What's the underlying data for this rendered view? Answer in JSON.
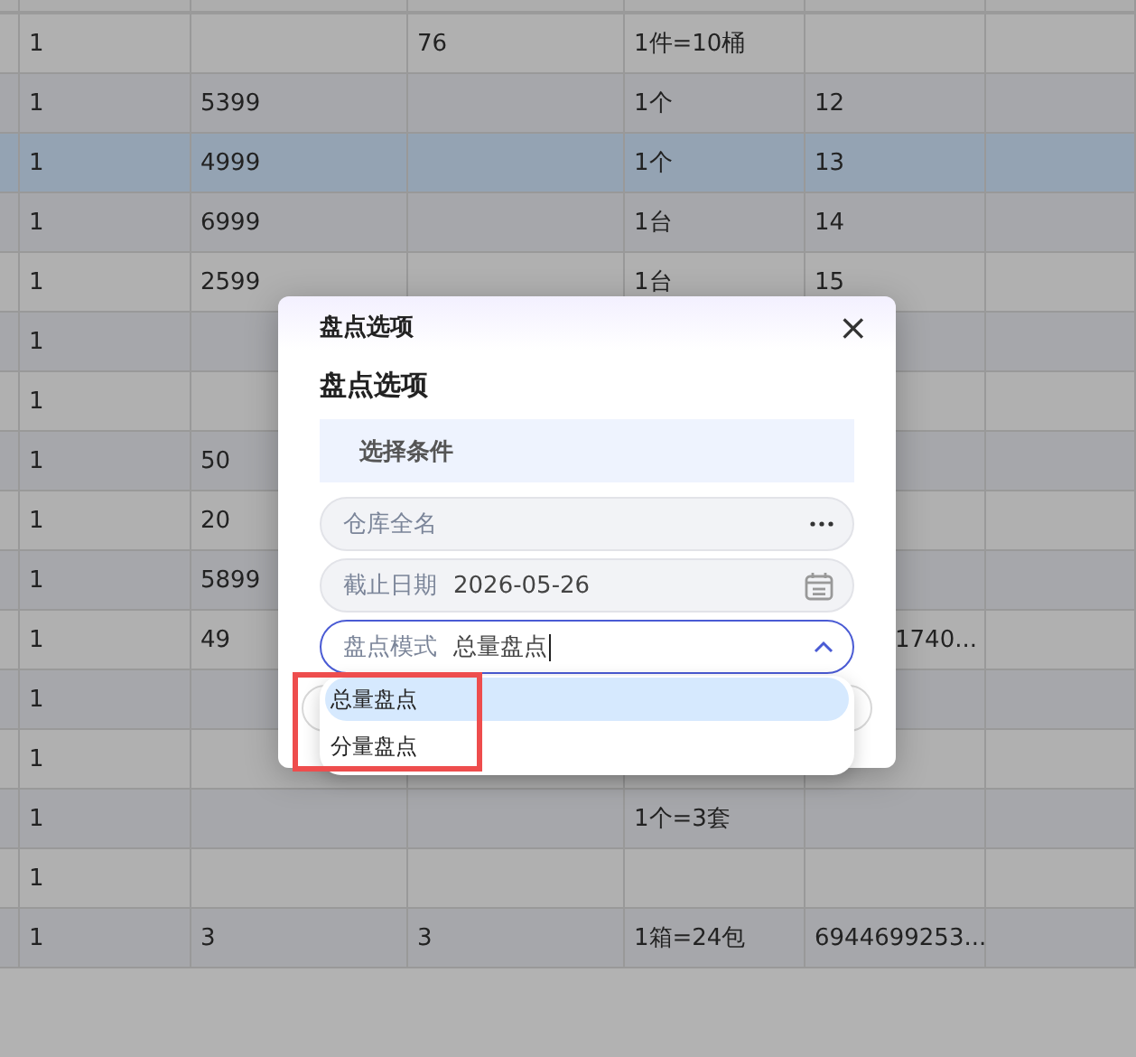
{
  "table": {
    "rows": [
      {
        "selected": false,
        "cells": [
          "1",
          "",
          "76",
          "1件=10桶",
          ""
        ]
      },
      {
        "selected": false,
        "cells": [
          "1",
          "5399",
          "",
          "1个",
          "12"
        ]
      },
      {
        "selected": true,
        "cells": [
          "1",
          "4999",
          "",
          "1个",
          "13"
        ]
      },
      {
        "selected": false,
        "cells": [
          "1",
          "6999",
          "",
          "1台",
          "14"
        ]
      },
      {
        "selected": false,
        "cells": [
          "1",
          "2599",
          "",
          "1台",
          "15"
        ]
      },
      {
        "selected": false,
        "cells": [
          "1",
          "",
          "",
          "",
          ""
        ]
      },
      {
        "selected": false,
        "cells": [
          "1",
          "",
          "",
          "",
          ""
        ]
      },
      {
        "selected": false,
        "cells": [
          "1",
          "50",
          "",
          "",
          ""
        ]
      },
      {
        "selected": false,
        "cells": [
          "1",
          "20",
          "",
          "",
          ""
        ]
      },
      {
        "selected": false,
        "cells": [
          "1",
          "5899",
          "",
          "",
          ""
        ]
      },
      {
        "selected": false,
        "cells": [
          "1",
          "49",
          "",
          "",
          {
            "text": "1740...",
            "covered": true
          }
        ]
      },
      {
        "selected": false,
        "cells": [
          "1",
          "",
          "",
          "",
          ""
        ]
      },
      {
        "selected": false,
        "cells": [
          "1",
          "",
          "",
          "",
          ""
        ]
      },
      {
        "selected": false,
        "cells": [
          "1",
          "",
          "",
          "1个=3套",
          ""
        ]
      },
      {
        "selected": false,
        "cells": [
          "1",
          "",
          "",
          "",
          ""
        ]
      },
      {
        "selected": false,
        "cells": [
          "1",
          "3",
          "3",
          "1箱=24包",
          "6944699253..."
        ]
      }
    ]
  },
  "dialog": {
    "title": "盘点选项",
    "close": "×",
    "heading": "盘点选项",
    "section": "选择条件",
    "fields": [
      {
        "kind": "browse",
        "placeholder": "仓库全名",
        "focused": false
      },
      {
        "kind": "date",
        "label": "截止日期",
        "value": "2026-05-26",
        "focused": false
      },
      {
        "kind": "select",
        "label": "盘点模式",
        "value": "总量盘点",
        "focused": true
      }
    ],
    "dropdown": {
      "options": [
        {
          "label": "总量盘点",
          "selected": true
        },
        {
          "label": "分量盘点",
          "selected": false
        }
      ]
    }
  }
}
